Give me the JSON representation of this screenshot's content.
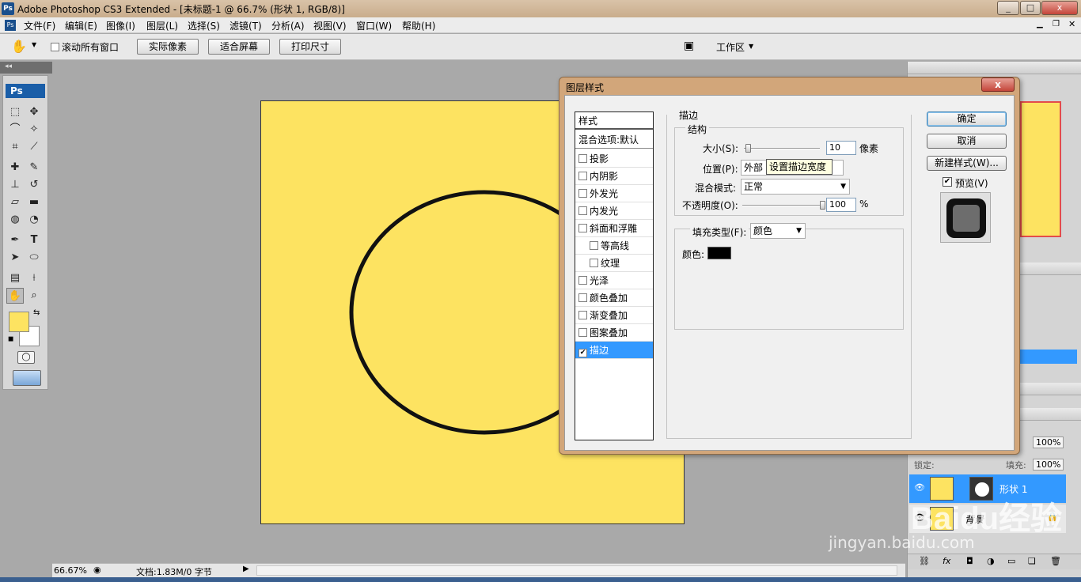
{
  "window": {
    "logo": "Ps",
    "title": "Adobe Photoshop CS3 Extended - [未标题-1 @ 66.7% (形状 1, RGB/8)]"
  },
  "menu": [
    "文件(F)",
    "编辑(E)",
    "图像(I)",
    "图层(L)",
    "选择(S)",
    "滤镜(T)",
    "分析(A)",
    "视图(V)",
    "窗口(W)",
    "帮助(H)"
  ],
  "options": {
    "scroll_all_label": "滚动所有窗口",
    "actual_pixels": "实际像素",
    "fit_screen": "适合屏幕",
    "print_size": "打印尺寸",
    "workspace": "工作区"
  },
  "tools": {
    "logo": "Ps"
  },
  "status": {
    "zoom": "66.67%",
    "doc_info": "文档:1.83M/0 字节"
  },
  "dialog": {
    "title": "图层样式",
    "close": "x",
    "styles_header": "样式",
    "blend_options": "混合选项:默认",
    "style_items": [
      {
        "label": "投影",
        "checked": false
      },
      {
        "label": "内阴影",
        "checked": false
      },
      {
        "label": "外发光",
        "checked": false
      },
      {
        "label": "内发光",
        "checked": false
      },
      {
        "label": "斜面和浮雕",
        "checked": false
      },
      {
        "label": "等高线",
        "checked": false
      },
      {
        "label": "纹理",
        "checked": false
      },
      {
        "label": "光泽",
        "checked": false
      },
      {
        "label": "颜色叠加",
        "checked": false
      },
      {
        "label": "渐变叠加",
        "checked": false
      },
      {
        "label": "图案叠加",
        "checked": false
      },
      {
        "label": "描边",
        "checked": true
      }
    ],
    "stroke": {
      "section": "描边",
      "structure": "结构",
      "size_label": "大小(S):",
      "size_value": "10",
      "size_unit": "像素",
      "size_slider": 0.05,
      "position_label": "位置(P):",
      "position_value": "外部",
      "tooltip": "设置描边宽度",
      "blend_label": "混合模式:",
      "blend_value": "正常",
      "opacity_label": "不透明度(O):",
      "opacity_value": "100",
      "opacity_unit": "%",
      "opacity_slider": 1.0,
      "fill_type_label": "填充类型(F):",
      "fill_type_value": "颜色",
      "color_label": "颜色:",
      "color_value": "#000000"
    },
    "buttons": {
      "ok": "确定",
      "cancel": "取消",
      "new_style": "新建样式(W)...",
      "preview": "预览(V)"
    }
  },
  "layers": {
    "lock_label": "锁定:",
    "fill_label": "填充:",
    "fill_value": "100%",
    "opacity_value": "100%",
    "items": [
      {
        "name": "形状 1",
        "selected": true
      },
      {
        "name": "背景",
        "selected": false
      }
    ]
  },
  "watermark": {
    "brand": "Baidu经验",
    "url": "jingyan.baidu.com"
  },
  "colors": {
    "canvas": "#fde361",
    "selection": "#3399ff",
    "foreground": "#fde361"
  }
}
